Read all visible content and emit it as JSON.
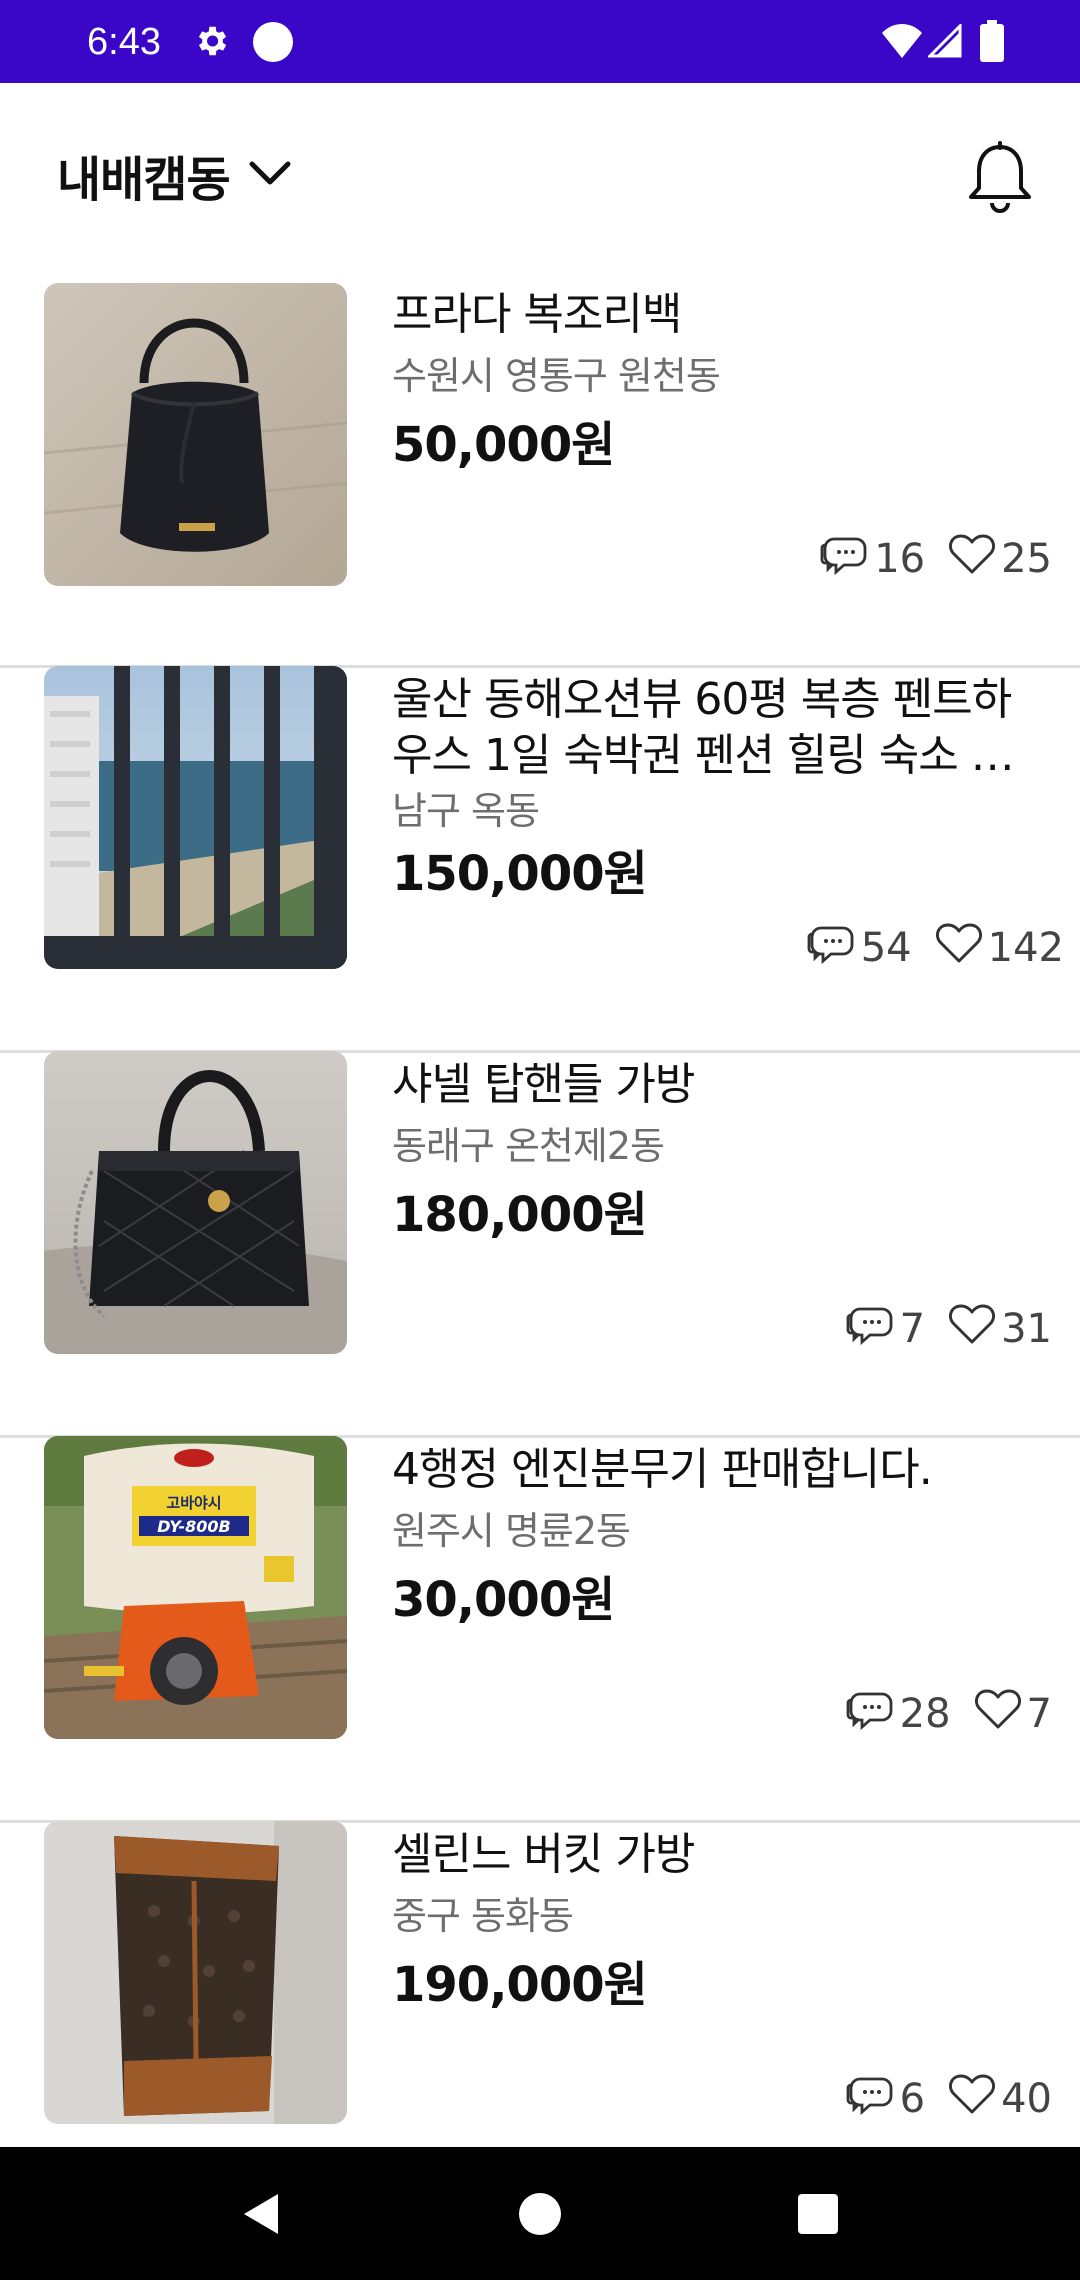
{
  "status_bar": {
    "time": "6:43",
    "icons": [
      "gear-icon",
      "circle-icon",
      "wifi-icon",
      "signal-icon",
      "battery-icon"
    ],
    "background": "#3a06c8"
  },
  "header": {
    "location": "내배캠동",
    "dropdown_icon": "chevron-down-icon",
    "notification_icon": "bell-icon"
  },
  "items": [
    {
      "title": "프라다 복조리백",
      "region": "수원시 영통구 원천동",
      "price": "50,000원",
      "chats": "16",
      "likes": "25",
      "image": "black-bucket-bag"
    },
    {
      "title": "울산 동해오션뷰 60평 복층 펜트하우스 1일 숙박권 펜션 힐링 숙소 …",
      "region": "남구 옥동",
      "price": "150,000원",
      "chats": "54",
      "likes": "142",
      "image": "ocean-view-balcony"
    },
    {
      "title": "샤넬 탑핸들 가방",
      "region": "동래구 온천제2동",
      "price": "180,000원",
      "chats": "7",
      "likes": "31",
      "image": "quilted-handbag"
    },
    {
      "title": "4행정 엔진분무기 판매합니다.",
      "region": "원주시 명륜2동",
      "price": "30,000원",
      "chats": "28",
      "likes": "7",
      "image": "engine-sprayer",
      "image_label_top": "고바야시",
      "image_label_model": "DY-800B"
    },
    {
      "title": "셀린느 버킷 가방",
      "region": "중구 동화동",
      "price": "190,000원",
      "chats": "6",
      "likes": "40",
      "image": "brown-bucket-bag"
    }
  ],
  "nav_bar": {
    "buttons": [
      "back-icon",
      "home-icon",
      "recents-icon"
    ]
  }
}
